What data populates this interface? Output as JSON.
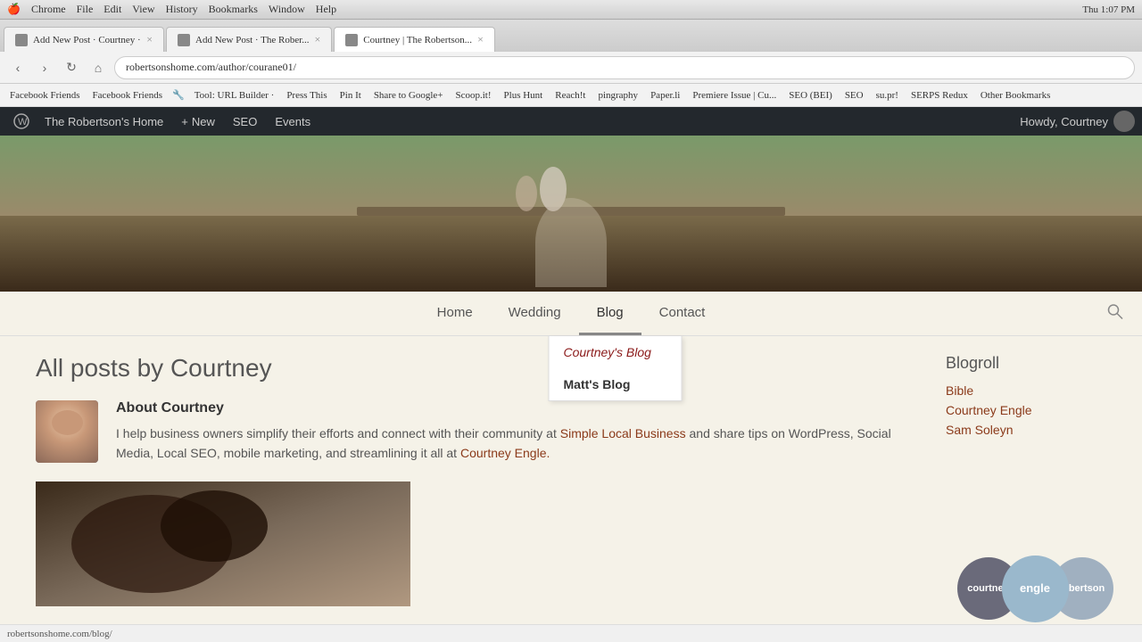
{
  "mac": {
    "app": "Chrome",
    "menus": [
      "Chrome",
      "File",
      "Edit",
      "View",
      "History",
      "Bookmarks",
      "Window",
      "Help"
    ],
    "time": "Thu 1:07 PM",
    "title": "Chrome"
  },
  "tabs": [
    {
      "label": "Add New Post · Courtney ·",
      "active": false
    },
    {
      "label": "Add New Post · The Rober...",
      "active": false
    },
    {
      "label": "Courtney | The Robertson...",
      "active": true
    }
  ],
  "toolbar": {
    "address": "robertsonshome.com/author/courane01/"
  },
  "bookmarks": [
    "Facebook Friends",
    "Facebook Friends",
    "Tool: URL Builder ·",
    "Press This",
    "Pin It",
    "Share to Google+",
    "Scoop.it!",
    "Plus Hunt",
    "Reach!t",
    "pingraphy",
    "Paper.li",
    "Premiere Issue | Cu...",
    "SEO (BEI)",
    "SEO",
    "su.pr!",
    "SERPS Redux",
    "Other Bookmarks"
  ],
  "wp_admin": {
    "site_name": "The Robertson's Home",
    "new_label": "New",
    "seo_label": "SEO",
    "events_label": "Events",
    "howdy": "Howdy, Courtney"
  },
  "site_nav": {
    "items": [
      {
        "label": "Home",
        "active": false
      },
      {
        "label": "Wedding",
        "active": false
      },
      {
        "label": "Blog",
        "active": true
      },
      {
        "label": "Contact",
        "active": false
      }
    ],
    "dropdown": {
      "items": [
        {
          "label": "Courtney's Blog",
          "active": true
        },
        {
          "label": "Matt's Blog",
          "active": false
        }
      ]
    }
  },
  "main": {
    "page_title": "All posts by Courtney",
    "author": {
      "name": "About Courtney",
      "bio": "I help business owners simplify their efforts and connect with their community at Simple Local Business and share tips on WordPress, Social Media, Local SEO, mobile marketing, and streamlining it all at Courtney Engle.",
      "link1_text": "Simple Local Business",
      "link2_text": "Courtney",
      "link3_text": "Engle."
    }
  },
  "sidebar": {
    "blogroll_title": "Blogroll",
    "links": [
      {
        "label": "Bible"
      },
      {
        "label": "Courtney Engle"
      },
      {
        "label": "Sam Soleyn"
      }
    ]
  },
  "logo": {
    "part1": "courtney",
    "part2": "engle",
    "part3": "robertson"
  },
  "status_bar": {
    "url": "robertsonshome.com/blog/"
  }
}
